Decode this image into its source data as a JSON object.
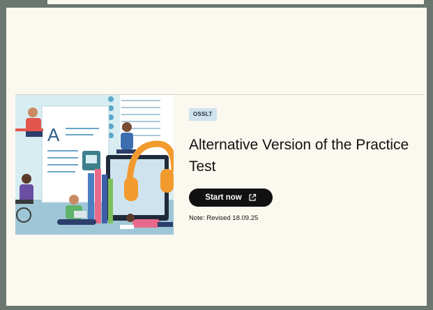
{
  "card": {
    "badge": "OSSLT",
    "title": "Alternative Version of the Practice Test",
    "button_label": "Start now",
    "button_icon": "external-link-icon",
    "note": "Note: Revised 18.09.25"
  },
  "illustration": {
    "letter": "A"
  },
  "colors": {
    "background": "#fbf8ef",
    "badge_bg": "#cfe3ef",
    "button_bg": "#111111",
    "accent_orange": "#f29a2e",
    "accent_blue": "#4a7fc1"
  }
}
